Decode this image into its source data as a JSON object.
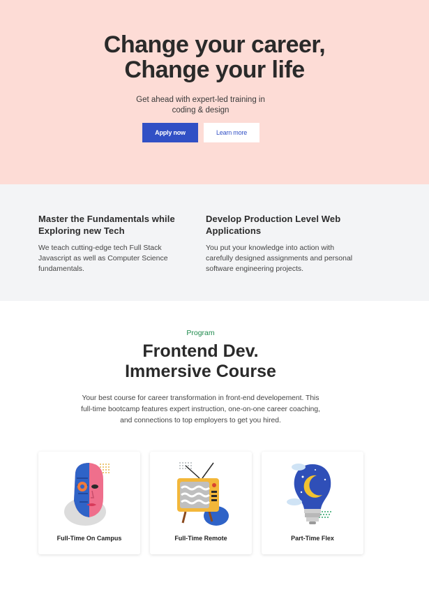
{
  "hero": {
    "title_line1": "Change your career,",
    "title_line2": "Change your life",
    "subtitle_line1": "Get ahead with expert-led training in",
    "subtitle_line2": "coding & design",
    "apply_label": "Apply now",
    "learn_label": "Learn more",
    "background": "#fddcd6",
    "accent": "#3150c5"
  },
  "features": [
    {
      "title_line1": "Master the Fundamentals while",
      "title_line2": "Exploring new Tech",
      "text_line1": "We teach cutting-edge tech Full Stack",
      "text_line2": "Javascript as well as Computer Science",
      "text_line3": "fundamentals."
    },
    {
      "title_line1": "Develop Production Level Web",
      "title_line2": "Applications",
      "text_line1": "You put your knowledge into action with",
      "text_line2": "carefully designed assignments and personal",
      "text_line3": "software engineering projects."
    }
  ],
  "program": {
    "eyebrow": "Program",
    "title_line1": "Frontend Dev.",
    "title_line2": "Immersive Course",
    "desc_line1": "Your best course for career transformation in front-end developement. This",
    "desc_line2": "full-time bootcamp features expert instruction, one-on-one career coaching,",
    "desc_line3": "and connections to top employers to get you hired.",
    "eyebrow_color": "#1e8a4c"
  },
  "cards": [
    {
      "label": "Full-Time On Campus",
      "icon": "cyborg-face-icon"
    },
    {
      "label": "Full-Time Remote",
      "icon": "retro-tv-icon"
    },
    {
      "label": "Part-Time Flex",
      "icon": "night-lightbulb-icon"
    }
  ]
}
